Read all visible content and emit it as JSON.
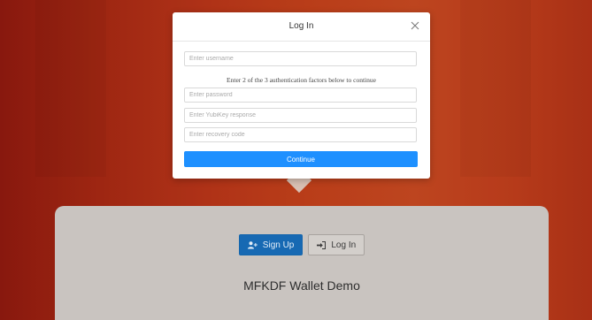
{
  "modal": {
    "title": "Log In",
    "username_placeholder": "Enter username",
    "instruction": "Enter 2 of the 3 authentication factors below to continue",
    "password_placeholder": "Enter password",
    "yubikey_placeholder": "Enter YubiKey response",
    "recovery_placeholder": "Enter recovery code",
    "continue_label": "Continue"
  },
  "card": {
    "signup_label": "Sign Up",
    "login_label": "Log In",
    "title": "MFKDF Wallet Demo"
  },
  "icons": {
    "close": "close-icon",
    "signup": "user-plus-icon",
    "login": "sign-in-icon"
  },
  "colors": {
    "primary": "#1e90ff",
    "signup_button": "#1769b3",
    "background": "#c4421c"
  }
}
